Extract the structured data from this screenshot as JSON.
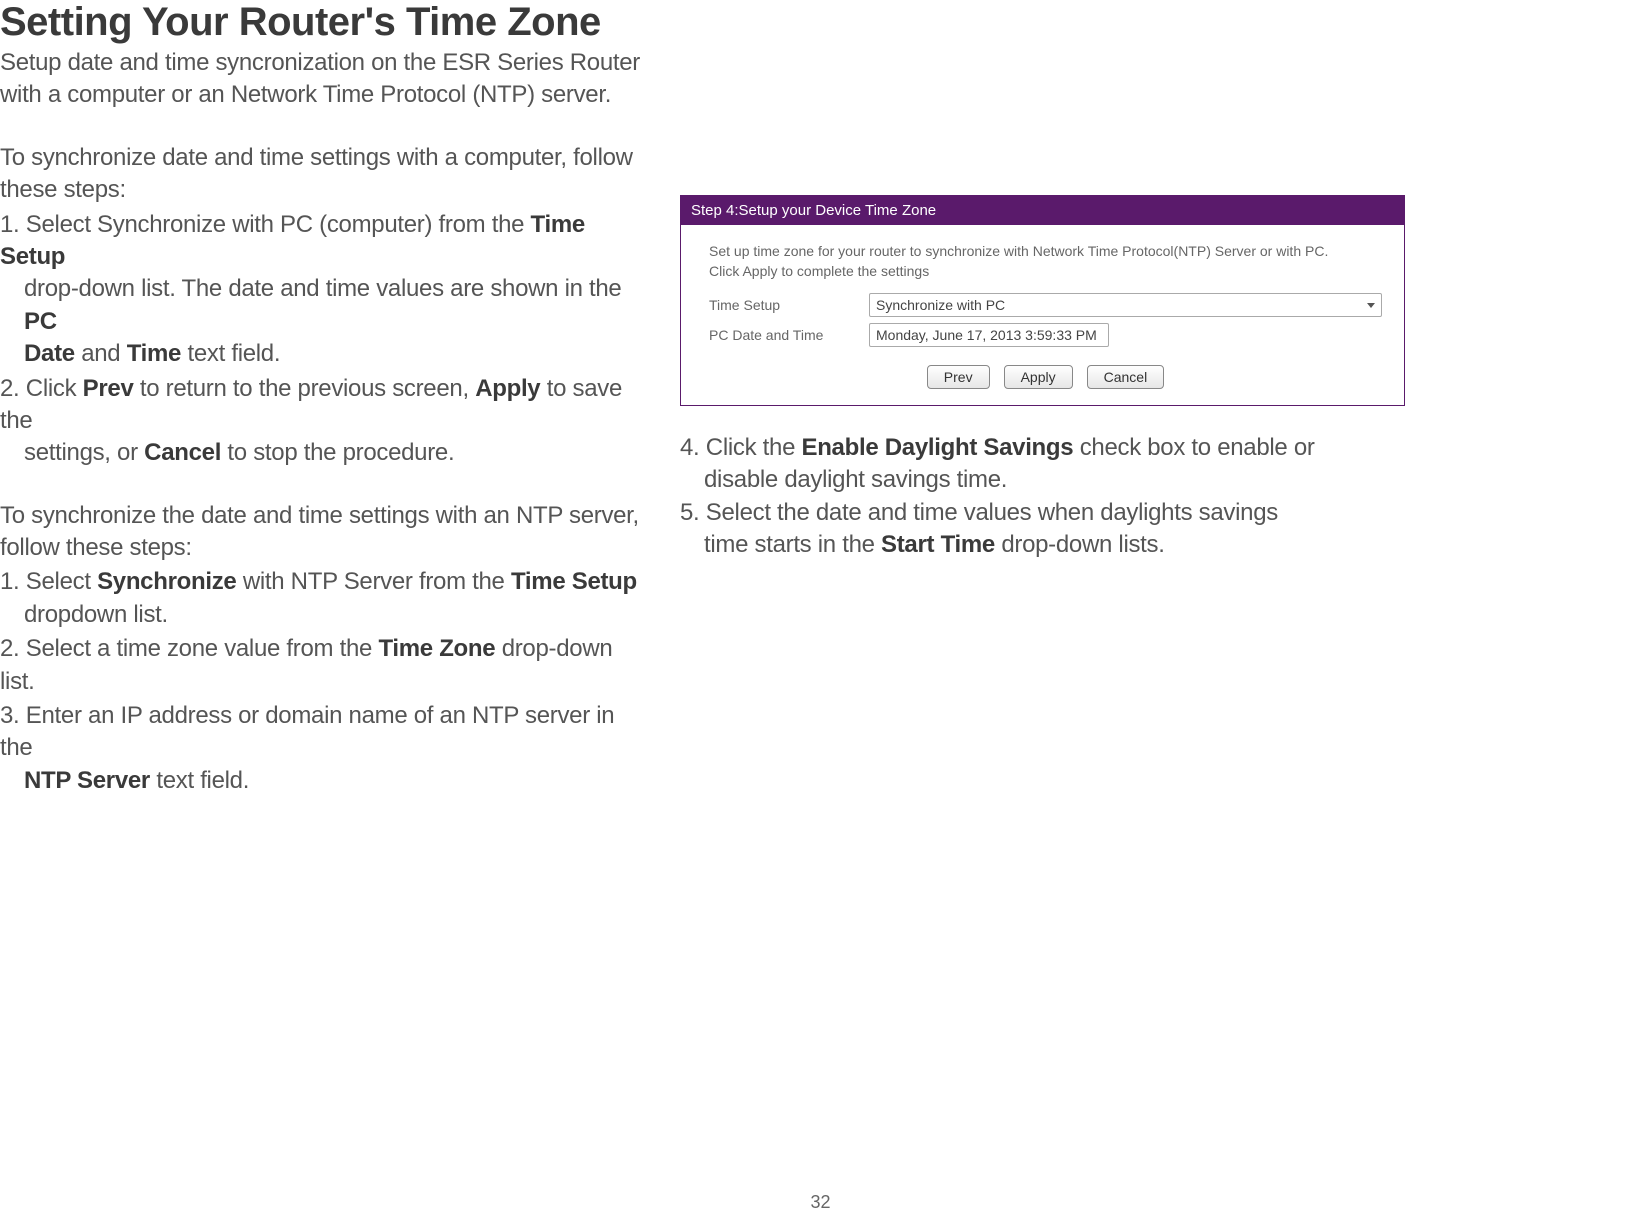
{
  "title": "Setting Your Router's Time Zone",
  "subtitle_line1": "Setup date and time syncronization on the ESR Series Router",
  "subtitle_line2": "with a computer or an Network Time Protocol (NTP) server.",
  "pc_intro_line1": "To synchronize date and time settings with a computer, follow",
  "pc_intro_line2": "these steps:",
  "pc_steps": {
    "s1a": "1. Select Synchronize with PC (computer) from the ",
    "s1b": "Time Setup",
    "s1c": "drop-down list. The date and time values are shown in the ",
    "s1d": "PC",
    "s1e": "Date",
    "s1f": " and ",
    "s1g": "Time",
    "s1h": " text field.",
    "s2a": "2. Click ",
    "s2b": "Prev",
    "s2c": " to return to the previous screen, ",
    "s2d": "Apply",
    "s2e": " to save the",
    "s2f": "settings, or ",
    "s2g": "Cancel",
    "s2h": " to stop the procedure."
  },
  "ntp_intro_line1": "To synchronize the date and time settings with an NTP server,",
  "ntp_intro_line2": "follow these steps:",
  "ntp_steps": {
    "s1a": "1. Select ",
    "s1b": "Synchronize",
    "s1c": " with NTP Server from the ",
    "s1d": "Time Setup",
    "s1e": "dropdown list.",
    "s2a": "2. Select a time zone value from the ",
    "s2b": "Time Zone",
    "s2c": " drop-down list.",
    "s3a": "3. Enter an IP address or domain name of an NTP server in the",
    "s3b": "NTP Server",
    "s3c": " text field."
  },
  "right_steps": {
    "s4a": "4. Click the ",
    "s4b": "Enable Daylight Savings",
    "s4c": " check box to enable or",
    "s4d": "disable daylight savings time.",
    "s5a": "5. Select the date and time values when daylights savings",
    "s5b": "time starts in the ",
    "s5c": "Start Time",
    "s5d": " drop-down lists."
  },
  "screenshot": {
    "header": "Step 4:Setup your Device Time Zone",
    "line1": "Set up time zone for your router to synchronize with Network Time Protocol(NTP) Server or with PC.",
    "line2": "Click Apply to complete the settings",
    "label_time_setup": "Time Setup",
    "value_time_setup": "Synchronize with PC",
    "label_pc_datetime": "PC Date and Time",
    "value_pc_datetime": "Monday, June 17, 2013 3:59:33 PM",
    "btn_prev": "Prev",
    "btn_apply": "Apply",
    "btn_cancel": "Cancel"
  },
  "page_number": "32"
}
